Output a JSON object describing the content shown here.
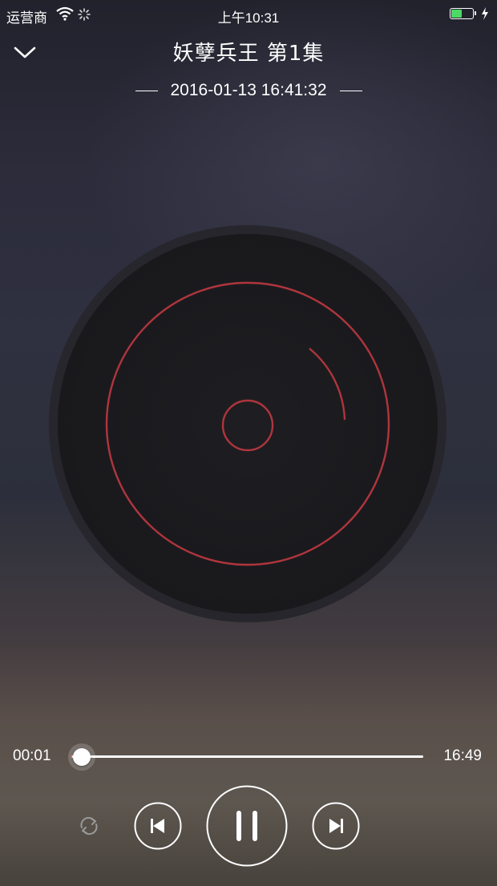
{
  "status_bar": {
    "carrier": "运营商",
    "time": "上午10:31",
    "battery_level": 0.55,
    "battery_color": "#4cd964"
  },
  "header": {
    "title": "妖孽兵王 第1集",
    "subtitle": "2016-01-13 16:41:32",
    "collapse_icon": "chevron-down-icon"
  },
  "disc": {
    "accent_color": "#b0353d"
  },
  "player": {
    "current_time": "00:01",
    "total_time": "16:49",
    "progress": 0.001,
    "accent_color": "#e03b3b"
  },
  "controls": {
    "repeat_icon": "repeat-icon",
    "previous_icon": "skip-previous-icon",
    "pause_icon": "pause-icon",
    "next_icon": "skip-next-icon"
  }
}
